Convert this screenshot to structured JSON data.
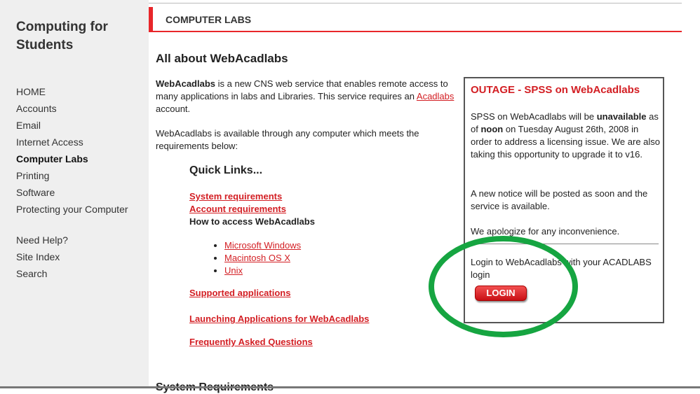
{
  "site": {
    "title": "Computing for Students"
  },
  "nav": {
    "items": [
      "HOME",
      "Accounts",
      "Email",
      "Internet Access",
      "Computer Labs",
      "Printing",
      "Software",
      "Protecting your Computer"
    ],
    "help": [
      "Need Help?",
      "Site Index",
      "Search"
    ]
  },
  "header": {
    "title": "COMPUTER LABS"
  },
  "main": {
    "title": "All about WebAcadlabs",
    "intro_bold": "WebAcadlabs",
    "intro_text_1": " is a new CNS web service that enables remote access to many applications in labs and Libraries. This service requires an ",
    "intro_link": "Acadlabs ",
    "intro_text_2": "account.",
    "availability": "WebAcadlabs is available through any computer which meets the requirements below:",
    "quick_links_title": "Quick Links...",
    "links": {
      "system_requirements": "System requirements",
      "account_requirements": "Account requirements",
      "how_to_access": "How to access WebAcadlabs",
      "os": [
        "Microsoft Windows",
        "Macintosh OS X",
        "Unix"
      ],
      "supported_applications": "Supported applications",
      "launching": "Launching Applications for WebAcadlabs",
      "faq": "Frequently Asked Questions"
    },
    "next_section": "System Requirements"
  },
  "outage": {
    "title": "OUTAGE - SPSS on WebAcadlabs",
    "text_1": "SPSS on WebAcadlabs will be ",
    "bold_1": "unavailable",
    "text_2": " as of ",
    "bold_2": "noon",
    "text_3": " on Tuesday August 26th, 2008 in order to address a licensing issue. We are also taking this opportunity to upgrade it to v16.",
    "notice": "A new notice will be posted as soon and the service is available.",
    "apology": "We apologize for any inconvenience.",
    "login_text": "Login to WebAcadlabs with your ACADLABS login",
    "login_button": "LOGIN"
  },
  "colors": {
    "accent_red": "#d31e23",
    "highlight_green": "#16a541",
    "sidebar_bg": "#efefef"
  }
}
